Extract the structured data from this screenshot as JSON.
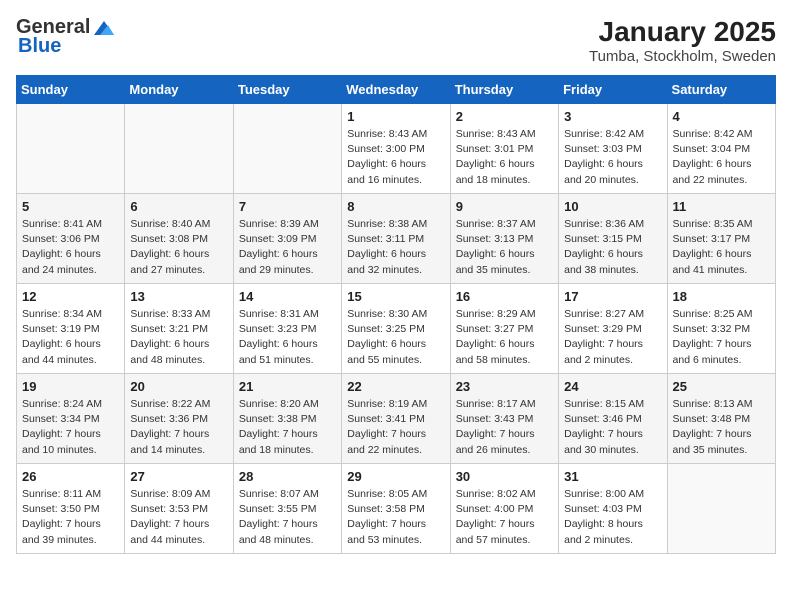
{
  "header": {
    "logo_general": "General",
    "logo_blue": "Blue",
    "month_year": "January 2025",
    "location": "Tumba, Stockholm, Sweden"
  },
  "weekdays": [
    "Sunday",
    "Monday",
    "Tuesday",
    "Wednesday",
    "Thursday",
    "Friday",
    "Saturday"
  ],
  "weeks": [
    [
      {
        "day": "",
        "sunrise": "",
        "sunset": "",
        "daylight": ""
      },
      {
        "day": "",
        "sunrise": "",
        "sunset": "",
        "daylight": ""
      },
      {
        "day": "",
        "sunrise": "",
        "sunset": "",
        "daylight": ""
      },
      {
        "day": "1",
        "sunrise": "Sunrise: 8:43 AM",
        "sunset": "Sunset: 3:00 PM",
        "daylight": "Daylight: 6 hours and 16 minutes."
      },
      {
        "day": "2",
        "sunrise": "Sunrise: 8:43 AM",
        "sunset": "Sunset: 3:01 PM",
        "daylight": "Daylight: 6 hours and 18 minutes."
      },
      {
        "day": "3",
        "sunrise": "Sunrise: 8:42 AM",
        "sunset": "Sunset: 3:03 PM",
        "daylight": "Daylight: 6 hours and 20 minutes."
      },
      {
        "day": "4",
        "sunrise": "Sunrise: 8:42 AM",
        "sunset": "Sunset: 3:04 PM",
        "daylight": "Daylight: 6 hours and 22 minutes."
      }
    ],
    [
      {
        "day": "5",
        "sunrise": "Sunrise: 8:41 AM",
        "sunset": "Sunset: 3:06 PM",
        "daylight": "Daylight: 6 hours and 24 minutes."
      },
      {
        "day": "6",
        "sunrise": "Sunrise: 8:40 AM",
        "sunset": "Sunset: 3:08 PM",
        "daylight": "Daylight: 6 hours and 27 minutes."
      },
      {
        "day": "7",
        "sunrise": "Sunrise: 8:39 AM",
        "sunset": "Sunset: 3:09 PM",
        "daylight": "Daylight: 6 hours and 29 minutes."
      },
      {
        "day": "8",
        "sunrise": "Sunrise: 8:38 AM",
        "sunset": "Sunset: 3:11 PM",
        "daylight": "Daylight: 6 hours and 32 minutes."
      },
      {
        "day": "9",
        "sunrise": "Sunrise: 8:37 AM",
        "sunset": "Sunset: 3:13 PM",
        "daylight": "Daylight: 6 hours and 35 minutes."
      },
      {
        "day": "10",
        "sunrise": "Sunrise: 8:36 AM",
        "sunset": "Sunset: 3:15 PM",
        "daylight": "Daylight: 6 hours and 38 minutes."
      },
      {
        "day": "11",
        "sunrise": "Sunrise: 8:35 AM",
        "sunset": "Sunset: 3:17 PM",
        "daylight": "Daylight: 6 hours and 41 minutes."
      }
    ],
    [
      {
        "day": "12",
        "sunrise": "Sunrise: 8:34 AM",
        "sunset": "Sunset: 3:19 PM",
        "daylight": "Daylight: 6 hours and 44 minutes."
      },
      {
        "day": "13",
        "sunrise": "Sunrise: 8:33 AM",
        "sunset": "Sunset: 3:21 PM",
        "daylight": "Daylight: 6 hours and 48 minutes."
      },
      {
        "day": "14",
        "sunrise": "Sunrise: 8:31 AM",
        "sunset": "Sunset: 3:23 PM",
        "daylight": "Daylight: 6 hours and 51 minutes."
      },
      {
        "day": "15",
        "sunrise": "Sunrise: 8:30 AM",
        "sunset": "Sunset: 3:25 PM",
        "daylight": "Daylight: 6 hours and 55 minutes."
      },
      {
        "day": "16",
        "sunrise": "Sunrise: 8:29 AM",
        "sunset": "Sunset: 3:27 PM",
        "daylight": "Daylight: 6 hours and 58 minutes."
      },
      {
        "day": "17",
        "sunrise": "Sunrise: 8:27 AM",
        "sunset": "Sunset: 3:29 PM",
        "daylight": "Daylight: 7 hours and 2 minutes."
      },
      {
        "day": "18",
        "sunrise": "Sunrise: 8:25 AM",
        "sunset": "Sunset: 3:32 PM",
        "daylight": "Daylight: 7 hours and 6 minutes."
      }
    ],
    [
      {
        "day": "19",
        "sunrise": "Sunrise: 8:24 AM",
        "sunset": "Sunset: 3:34 PM",
        "daylight": "Daylight: 7 hours and 10 minutes."
      },
      {
        "day": "20",
        "sunrise": "Sunrise: 8:22 AM",
        "sunset": "Sunset: 3:36 PM",
        "daylight": "Daylight: 7 hours and 14 minutes."
      },
      {
        "day": "21",
        "sunrise": "Sunrise: 8:20 AM",
        "sunset": "Sunset: 3:38 PM",
        "daylight": "Daylight: 7 hours and 18 minutes."
      },
      {
        "day": "22",
        "sunrise": "Sunrise: 8:19 AM",
        "sunset": "Sunset: 3:41 PM",
        "daylight": "Daylight: 7 hours and 22 minutes."
      },
      {
        "day": "23",
        "sunrise": "Sunrise: 8:17 AM",
        "sunset": "Sunset: 3:43 PM",
        "daylight": "Daylight: 7 hours and 26 minutes."
      },
      {
        "day": "24",
        "sunrise": "Sunrise: 8:15 AM",
        "sunset": "Sunset: 3:46 PM",
        "daylight": "Daylight: 7 hours and 30 minutes."
      },
      {
        "day": "25",
        "sunrise": "Sunrise: 8:13 AM",
        "sunset": "Sunset: 3:48 PM",
        "daylight": "Daylight: 7 hours and 35 minutes."
      }
    ],
    [
      {
        "day": "26",
        "sunrise": "Sunrise: 8:11 AM",
        "sunset": "Sunset: 3:50 PM",
        "daylight": "Daylight: 7 hours and 39 minutes."
      },
      {
        "day": "27",
        "sunrise": "Sunrise: 8:09 AM",
        "sunset": "Sunset: 3:53 PM",
        "daylight": "Daylight: 7 hours and 44 minutes."
      },
      {
        "day": "28",
        "sunrise": "Sunrise: 8:07 AM",
        "sunset": "Sunset: 3:55 PM",
        "daylight": "Daylight: 7 hours and 48 minutes."
      },
      {
        "day": "29",
        "sunrise": "Sunrise: 8:05 AM",
        "sunset": "Sunset: 3:58 PM",
        "daylight": "Daylight: 7 hours and 53 minutes."
      },
      {
        "day": "30",
        "sunrise": "Sunrise: 8:02 AM",
        "sunset": "Sunset: 4:00 PM",
        "daylight": "Daylight: 7 hours and 57 minutes."
      },
      {
        "day": "31",
        "sunrise": "Sunrise: 8:00 AM",
        "sunset": "Sunset: 4:03 PM",
        "daylight": "Daylight: 8 hours and 2 minutes."
      },
      {
        "day": "",
        "sunrise": "",
        "sunset": "",
        "daylight": ""
      }
    ]
  ]
}
